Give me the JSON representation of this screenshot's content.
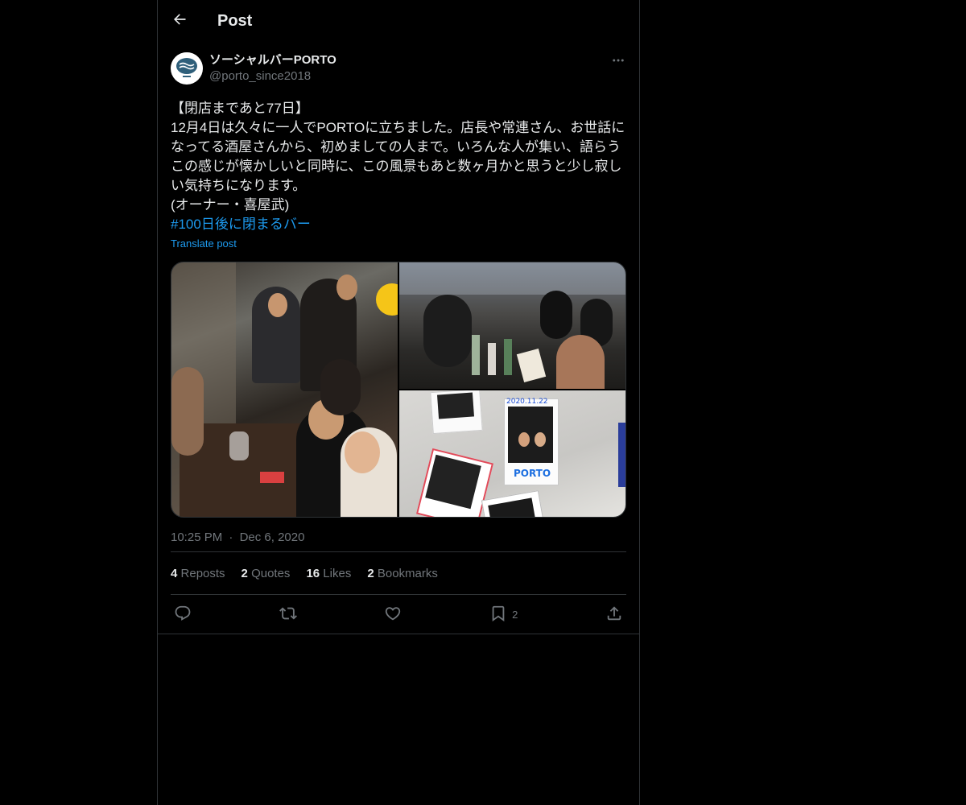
{
  "header": {
    "title": "Post",
    "back_icon": "arrow-left-icon"
  },
  "author": {
    "display_name": "ソーシャルバーPORTO",
    "handle": "@porto_since2018",
    "avatar_icon": "porto-logo-icon",
    "more_icon": "more-horizontal-icon"
  },
  "post": {
    "text": "【閉店まであと77日】\n12月4日は久々に一人でPORTOに立ちました。店長や常連さん、お世話になってる酒屋さんから、初めましての人まで。いろんな人が集い、語らうこの感じが懐かしいと同時に、この風景もあと数ヶ月かと思うと少し寂しい気持ちになります。\n(オーナー・喜屋武)",
    "hashtag": "#100日後に閉まるバー",
    "translate_label": "Translate post",
    "photos": [
      {
        "name": "group-photo-at-bar"
      },
      {
        "name": "bar-counter-photo"
      },
      {
        "name": "instant-photos-on-wall",
        "instax_date": "2020.11.22",
        "instax_label": "PORTO"
      }
    ],
    "time": "10:25 PM",
    "separator": "·",
    "date": "Dec 6, 2020"
  },
  "stats": [
    {
      "num": "4",
      "label": "Reposts"
    },
    {
      "num": "2",
      "label": "Quotes"
    },
    {
      "num": "16",
      "label": "Likes"
    },
    {
      "num": "2",
      "label": "Bookmarks"
    }
  ],
  "actions": {
    "reply_icon": "reply-icon",
    "repost_icon": "repost-icon",
    "like_icon": "heart-icon",
    "bookmark_icon": "bookmark-icon",
    "bookmark_count": "2",
    "share_icon": "share-icon"
  },
  "colors": {
    "accent": "#1d9bf0",
    "background": "#000000",
    "text": "#e7e9ea",
    "muted": "#71767b",
    "border": "#2f3336"
  }
}
